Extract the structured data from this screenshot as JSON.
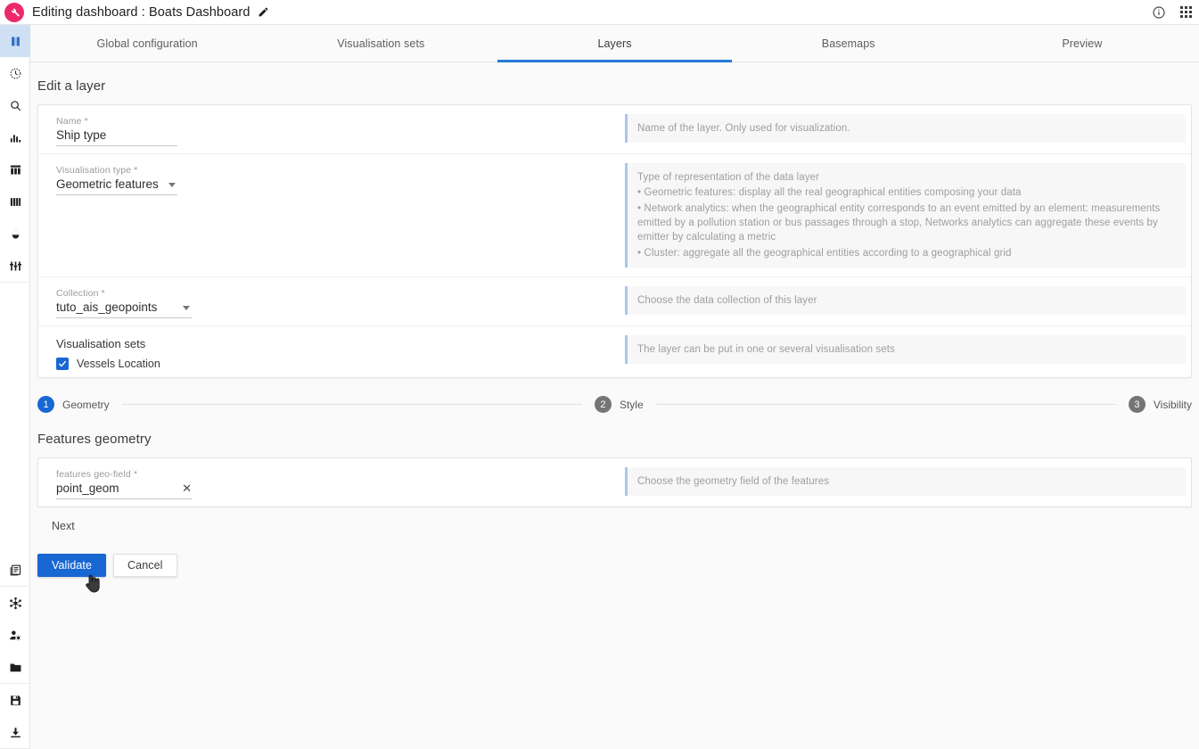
{
  "topbar": {
    "title": "Editing dashboard : Boats Dashboard",
    "logo_icon": "wrench-logo-icon",
    "edit_icon": "pencil-icon",
    "info_icon": "info-circle-icon",
    "apps_icon": "apps-grid-icon",
    "brand_color": "#ec2a6a"
  },
  "rail": {
    "items": [
      {
        "icon": "map-icon",
        "active": true
      },
      {
        "icon": "clock-history-icon",
        "active": false
      },
      {
        "icon": "search-icon",
        "active": false
      },
      {
        "icon": "bar-chart-icon",
        "active": false
      },
      {
        "icon": "table-icon",
        "active": false
      },
      {
        "icon": "columns-icon",
        "active": false
      },
      {
        "icon": "droplet-icon",
        "active": false
      },
      {
        "icon": "sliders-icon",
        "active": false
      }
    ],
    "bottom_items": [
      {
        "icon": "pages-icon",
        "active": false
      },
      {
        "icon": "network-hub-icon",
        "active": false
      },
      {
        "icon": "user-settings-icon",
        "active": false
      },
      {
        "icon": "folder-icon",
        "active": false
      },
      {
        "icon": "save-icon",
        "active": false
      },
      {
        "icon": "download-icon",
        "active": false
      }
    ]
  },
  "tabs": {
    "active_index": 2,
    "items": [
      {
        "label": "Global configuration"
      },
      {
        "label": "Visualisation sets"
      },
      {
        "label": "Layers"
      },
      {
        "label": "Basemaps"
      },
      {
        "label": "Preview"
      }
    ],
    "active_color": "#2878d8"
  },
  "page": {
    "title": "Edit a layer"
  },
  "form": {
    "name": {
      "label": "Name *",
      "value": "Ship type",
      "help": "Name of the layer. Only used for visualization."
    },
    "visualisation_type": {
      "label": "Visualisation type *",
      "value": "Geometric features",
      "help_title": "Type of representation of the data layer",
      "help_lines": [
        "• Geometric features: display all the real geographical entities composing your data",
        "• Network analytics: when the geographical entity corresponds to an event emitted by an element: measurements emitted by a pollution station or bus passages through a stop, Networks analytics can aggregate these events by emitter by calculating a metric",
        "• Cluster: aggregate all the geographical entities according to a geographical grid"
      ]
    },
    "collection": {
      "label": "Collection *",
      "value": "tuto_ais_geopoints",
      "help": "Choose the data collection of this layer"
    },
    "visualisation_sets": {
      "title": "Visualisation sets",
      "help": "The layer can be put in one or several visualisation sets",
      "options": [
        {
          "label": "Vessels Location",
          "checked": true
        }
      ]
    }
  },
  "stepper": {
    "steps": [
      {
        "num": "1",
        "label": "Geometry",
        "active": true
      },
      {
        "num": "2",
        "label": "Style",
        "active": false
      },
      {
        "num": "3",
        "label": "Visibility",
        "active": false
      }
    ]
  },
  "geometry": {
    "title": "Features geometry",
    "geo_field": {
      "label": "features geo-field *",
      "value": "point_geom",
      "clear_icon": "close-x-icon",
      "help": "Choose the geometry field of the features"
    },
    "next_label": "Next"
  },
  "actions": {
    "validate_label": "Validate",
    "cancel_label": "Cancel",
    "primary_color": "#1967d2",
    "cursor_icon": "pointer-hand-cursor"
  }
}
